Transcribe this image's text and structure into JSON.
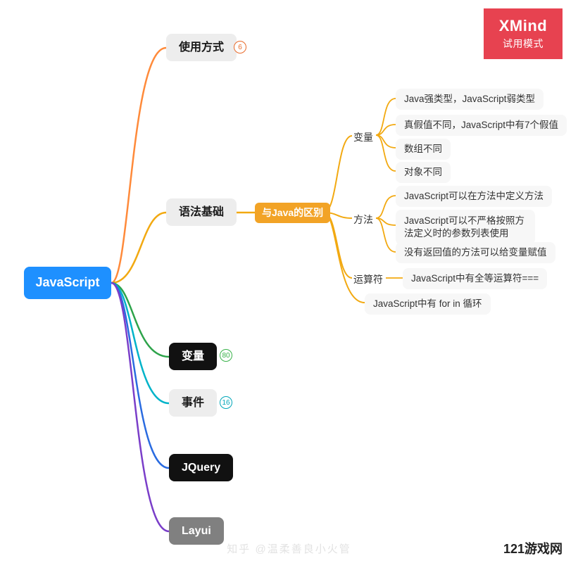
{
  "badge": {
    "line1": "XMind",
    "line2": "试用模式"
  },
  "footer": "121游戏网",
  "faint": "知乎 @温柔善良小火管",
  "root": {
    "label": "JavaScript"
  },
  "topics": {
    "usage": {
      "label": "使用方式",
      "count": "6"
    },
    "syntax": {
      "label": "语法基础"
    },
    "vars": {
      "label": "变量",
      "count": "80"
    },
    "events": {
      "label": "事件",
      "count": "16"
    },
    "jquery": {
      "label": "JQuery"
    },
    "layui": {
      "label": "Layui"
    }
  },
  "syntax_sub": {
    "java_diff": "与Java的区别"
  },
  "diff_groups": {
    "variables": {
      "label": "变量",
      "items": [
        "Java强类型，JavaScript弱类型",
        "真假值不同，JavaScript中有7个假值",
        "数组不同",
        "对象不同"
      ]
    },
    "methods": {
      "label": "方法",
      "items": [
        "JavaScript可以在方法中定义方法",
        "JavaScript可以不严格按照方法定义时的参数列表使用",
        "没有返回值的方法可以给变量赋值"
      ]
    },
    "operators": {
      "label": "运算符",
      "items": [
        "JavaScript中有全等运算符==="
      ]
    },
    "forin": {
      "label": "JavaScript中有 for in 循环"
    }
  }
}
